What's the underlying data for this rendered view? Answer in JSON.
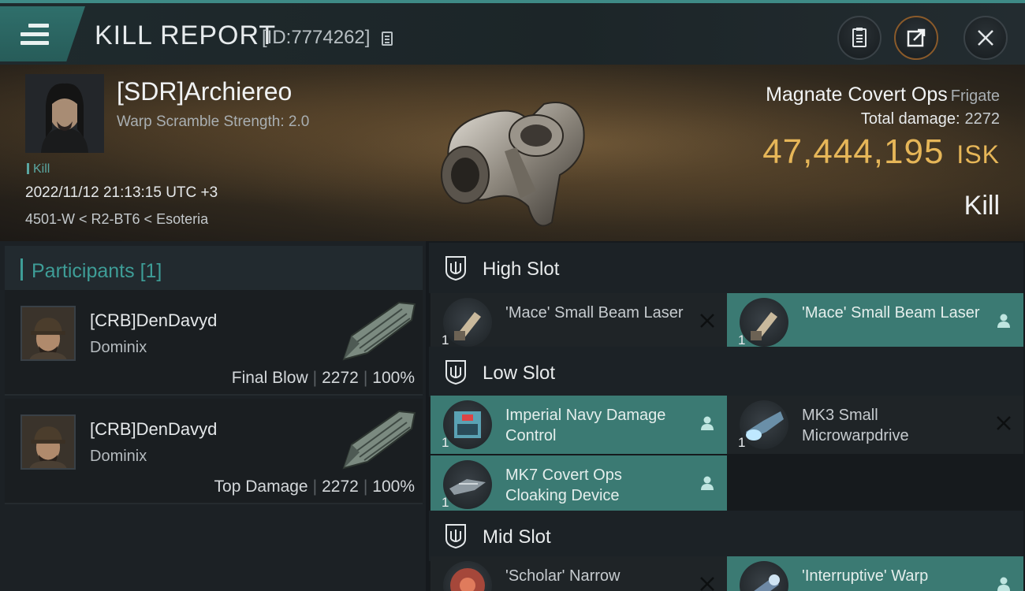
{
  "header": {
    "title": "KILL REPORT",
    "report_id": "[ID:7774262]"
  },
  "victim": {
    "name": "[SDR]Archiereo",
    "warp_scramble": "Warp Scramble Strength: 2.0",
    "tag": "Kill",
    "datetime": "2022/11/12 21:13:15 UTC +3",
    "location": "4501-W < R2-BT6 < Esoteria",
    "ship_name": "Magnate Covert Ops",
    "ship_class": "Frigate",
    "total_damage_label": "Total damage:",
    "total_damage": "2272",
    "isk_value": "47,444,195",
    "isk_unit": "ISK",
    "result": "Kill"
  },
  "participants": {
    "label": "Participants",
    "count": "[1]",
    "items": [
      {
        "name": "[CRB]DenDavyd",
        "ship": "Dominix",
        "role": "Final Blow",
        "damage": "2272",
        "percent": "100%"
      },
      {
        "name": "[CRB]DenDavyd",
        "ship": "Dominix",
        "role": "Top Damage",
        "damage": "2272",
        "percent": "100%"
      }
    ]
  },
  "slots": {
    "high": {
      "label": "High Slot",
      "items": [
        {
          "qty": "1",
          "name": "'Mace' Small Beam Laser",
          "status": "destroyed"
        },
        {
          "qty": "1",
          "name": "'Mace' Small Beam Laser",
          "status": "dropped"
        }
      ]
    },
    "low": {
      "label": "Low Slot",
      "items": [
        {
          "qty": "1",
          "name": "Imperial Navy Damage Control",
          "status": "dropped"
        },
        {
          "qty": "1",
          "name": "MK3 Small Microwarpdrive",
          "status": "destroyed"
        },
        {
          "qty": "1",
          "name": "MK7 Covert Ops Cloaking Device",
          "status": "dropped"
        }
      ]
    },
    "mid": {
      "label": "Mid Slot",
      "items": [
        {
          "qty": "1",
          "name": "'Scholar' Narrow",
          "status": "destroyed"
        },
        {
          "qty": "1",
          "name": "'Interruptive' Warp",
          "status": "dropped"
        }
      ]
    }
  },
  "colors": {
    "accent_teal": "#3e9d97",
    "dropped_bg": "#3b7a73",
    "isk_gold": "#e6b658"
  }
}
